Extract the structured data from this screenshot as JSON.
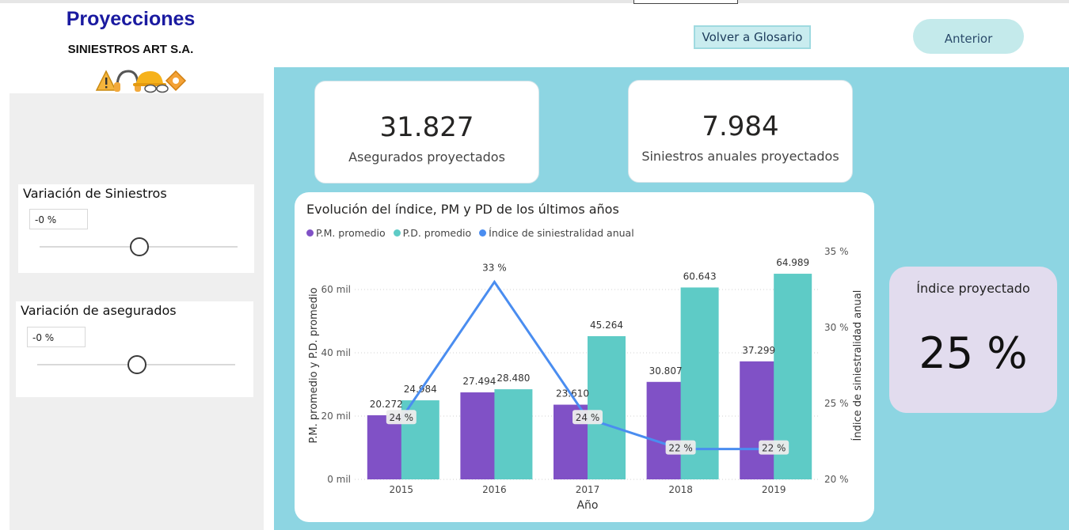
{
  "header": {
    "title": "Proyecciones",
    "company": "SINIESTROS ART S.A.",
    "glossary_button": "Volver a Glosario",
    "back_button": "Anterior"
  },
  "filters": {
    "siniestros": {
      "label": "Variación de Siniestros",
      "value": "-0 %",
      "slider_fraction": 0.5
    },
    "asegurados": {
      "label": "Variación de asegurados",
      "value": "-0 %",
      "slider_fraction": 0.5
    }
  },
  "kpis": {
    "asegurados": {
      "value": "31.827",
      "label": "Asegurados proyectados"
    },
    "siniestros": {
      "value": "7.984",
      "label": "Siniestros anuales proyectados"
    }
  },
  "indice_proyectado": {
    "label": "Índice proyectado",
    "value": "25 %"
  },
  "colors": {
    "pm": "#8051c6",
    "pd": "#5ecbc6",
    "indice": "#4a8df0",
    "canvas": "#8dd5e2",
    "brand": "#1a1aa0"
  },
  "icons": [
    "warning-sign-icon",
    "ear-protection-icon",
    "hard-hat-icon",
    "safety-goggles-icon",
    "hazard-sign-icon"
  ],
  "chart_data": {
    "type": "bar",
    "title": "Evolución del índice, PM y PD de los últimos años",
    "xlabel": "Año",
    "ylabel": "P.M. promedio y P.D. promedio",
    "y2label": "Índice de siniestralidad anual",
    "categories": [
      "2015",
      "2016",
      "2017",
      "2018",
      "2019"
    ],
    "ylim": [
      0,
      70000
    ],
    "yticks": [
      {
        "value": 0,
        "label": "0 mil"
      },
      {
        "value": 20000,
        "label": "20 mil"
      },
      {
        "value": 40000,
        "label": "40 mil"
      },
      {
        "value": 60000,
        "label": "60 mil"
      }
    ],
    "y2lim": [
      20,
      35
    ],
    "y2ticks": [
      {
        "value": 20,
        "label": "20 %"
      },
      {
        "value": 25,
        "label": "25 %"
      },
      {
        "value": 30,
        "label": "30 %"
      },
      {
        "value": 35,
        "label": "35 %"
      }
    ],
    "legend_position": "top-left",
    "grid": true,
    "series": [
      {
        "name": "P.M. promedio",
        "type": "bar",
        "values": [
          20272,
          27494,
          23610,
          30807,
          37299
        ],
        "labels": [
          "20.272",
          "27.494",
          "23.610",
          "30.807",
          "37.299"
        ]
      },
      {
        "name": "P.D. promedio",
        "type": "bar",
        "values": [
          24984,
          28480,
          45264,
          60643,
          64989
        ],
        "labels": [
          "24.984",
          "28.480",
          "45.264",
          "60.643",
          "64.989"
        ]
      },
      {
        "name": "Índice de siniestralidad anual",
        "type": "line",
        "axis": "y2",
        "values": [
          24,
          33,
          24,
          22,
          22
        ],
        "labels": [
          "24 %",
          "33 %",
          "24 %",
          "22 %",
          "22 %"
        ]
      }
    ]
  }
}
